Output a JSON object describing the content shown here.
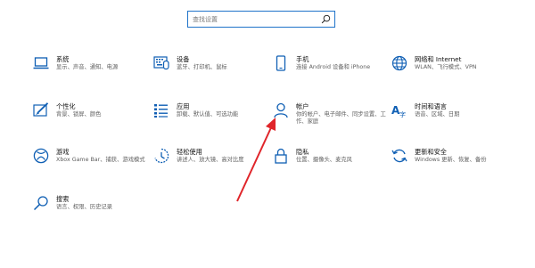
{
  "search": {
    "placeholder": "查找设置"
  },
  "tiles": [
    {
      "title": "系统",
      "desc": "显示、声音、通知、电源",
      "icon": "laptop-icon"
    },
    {
      "title": "设备",
      "desc": "蓝牙、打印机、鼠标",
      "icon": "devices-icon"
    },
    {
      "title": "手机",
      "desc": "连接 Android 设备和 iPhone",
      "icon": "phone-icon"
    },
    {
      "title": "网络和 Internet",
      "desc": "WLAN、飞行模式、VPN",
      "icon": "globe-icon"
    },
    {
      "title": "个性化",
      "desc": "背景、锁屏、颜色",
      "icon": "personalization-icon"
    },
    {
      "title": "应用",
      "desc": "卸载、默认值、可选功能",
      "icon": "apps-icon"
    },
    {
      "title": "帐户",
      "desc": "你的帐户、电子邮件、同步设置、工作、家庭",
      "icon": "person-icon"
    },
    {
      "title": "时间和语言",
      "desc": "语音、区域、日期",
      "icon": "time-language-icon"
    },
    {
      "title": "游戏",
      "desc": "Xbox Game Bar、捕获、游戏模式",
      "icon": "xbox-icon"
    },
    {
      "title": "轻松使用",
      "desc": "讲述人、放大镜、高对比度",
      "icon": "ease-of-access-icon"
    },
    {
      "title": "隐私",
      "desc": "位置、摄像头、麦克风",
      "icon": "lock-icon"
    },
    {
      "title": "更新和安全",
      "desc": "Windows 更新、恢复、备份",
      "icon": "update-icon"
    },
    {
      "title": "搜索",
      "desc": "语言、权限、历史记录",
      "icon": "search-icon"
    }
  ],
  "colors": {
    "accent": "#0f5fb4",
    "annotation_arrow": "#e0252a"
  }
}
